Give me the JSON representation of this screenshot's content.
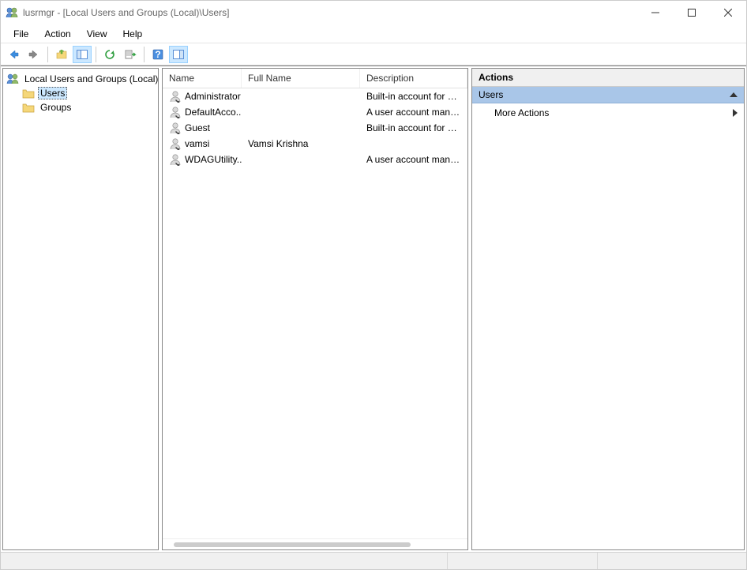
{
  "window": {
    "title": "lusrmgr - [Local Users and Groups (Local)\\Users]"
  },
  "menu": {
    "file": "File",
    "action": "Action",
    "view": "View",
    "help": "Help"
  },
  "tree": {
    "root": "Local Users and Groups (Local)",
    "users": "Users",
    "groups": "Groups"
  },
  "columns": {
    "name": "Name",
    "fullname": "Full Name",
    "description": "Description"
  },
  "users": [
    {
      "name": "Administrator",
      "fullname": "",
      "description": "Built-in account for administering the computer/domain"
    },
    {
      "name": "DefaultAcco...",
      "fullname": "",
      "description": "A user account managed by the system."
    },
    {
      "name": "Guest",
      "fullname": "",
      "description": "Built-in account for guest access to the computer/domain"
    },
    {
      "name": "vamsi",
      "fullname": "Vamsi Krishna",
      "description": ""
    },
    {
      "name": "WDAGUtility...",
      "fullname": "",
      "description": "A user account managed and used by the system for Windows Defender Application Guard scenarios."
    }
  ],
  "actions": {
    "header": "Actions",
    "section": "Users",
    "more": "More Actions"
  }
}
